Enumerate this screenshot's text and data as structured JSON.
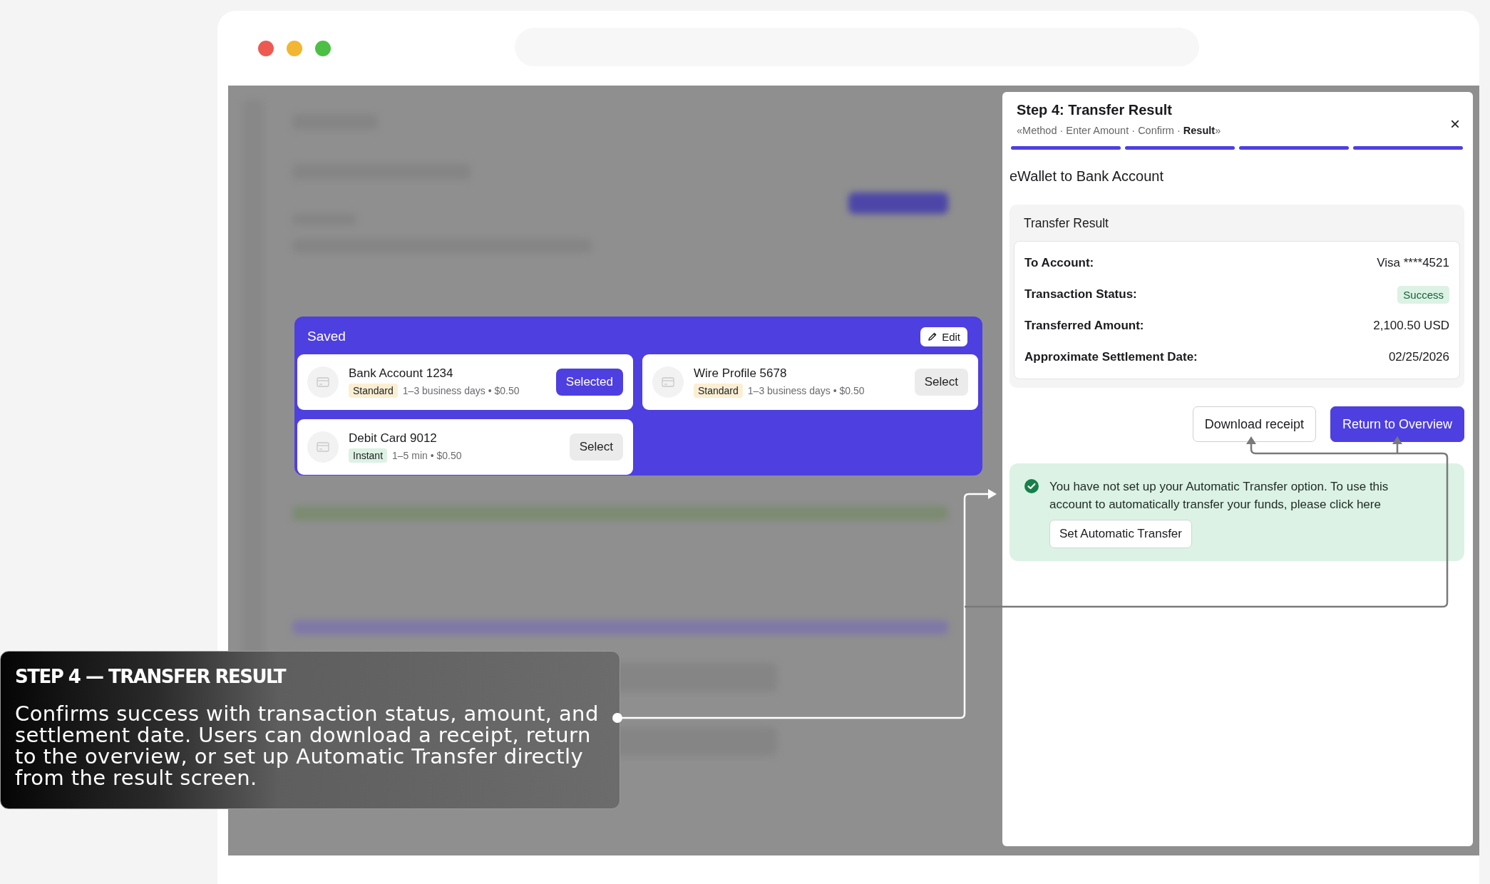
{
  "modal": {
    "title": "Step 4: Transfer Result",
    "breadcrumb": {
      "open": "«",
      "close": "»",
      "separator": "·",
      "steps": [
        {
          "label": "Method",
          "selected": false
        },
        {
          "label": "Enter Amount",
          "selected": false
        },
        {
          "label": "Confirm",
          "selected": false
        },
        {
          "label": "Result",
          "selected": true
        }
      ]
    },
    "close": "×",
    "progress": [
      {
        "done": true
      },
      {
        "done": true
      },
      {
        "done": true
      },
      {
        "done": true
      }
    ],
    "subtitle": "eWallet to Bank Account",
    "result": {
      "heading": "Transfer Result",
      "rows": [
        {
          "label": "To Account:",
          "value": "Visa ****4521",
          "kind": "text"
        },
        {
          "label": "Transaction Status:",
          "value": "Success",
          "kind": "badge"
        },
        {
          "label": "Transferred Amount:",
          "value": "2,100.50 USD",
          "kind": "text"
        },
        {
          "label": "Approximate Settlement Date:",
          "value": "02/25/2026",
          "kind": "text"
        }
      ]
    },
    "buttons": [
      {
        "label": "Download receipt",
        "kind": "secondary"
      },
      {
        "label": "Return to Overview",
        "kind": "primary"
      }
    ],
    "notice": {
      "text": "You have not set up your Automatic Transfer option. To use this account to automatically transfer your funds, please click here",
      "button": "Set Automatic Transfer"
    }
  },
  "saved": {
    "title": "Saved",
    "edit": "Edit",
    "accounts": [
      {
        "name": "Bank Account 1234",
        "tag": "Standard",
        "kind": "standard",
        "meta": "1–3 business days • $0.50",
        "button": "Selected",
        "selected": true
      },
      {
        "name": "Wire Profile 5678",
        "tag": "Standard",
        "kind": "standard",
        "meta": "1–3 business days • $0.50",
        "button": "Select",
        "selected": false
      },
      {
        "name": "Debit Card 9012",
        "tag": "Instant",
        "kind": "instant",
        "meta": "1–5 min • $0.50",
        "button": "Select",
        "selected": false
      }
    ]
  },
  "caption": {
    "heading": "STEP 4 — TRANSFER RESULT",
    "body": "Confirms success with transaction status, amount, and settlement date. Users can download a receipt, return to the overview, or set up Automatic Transfer directly from the result screen."
  }
}
